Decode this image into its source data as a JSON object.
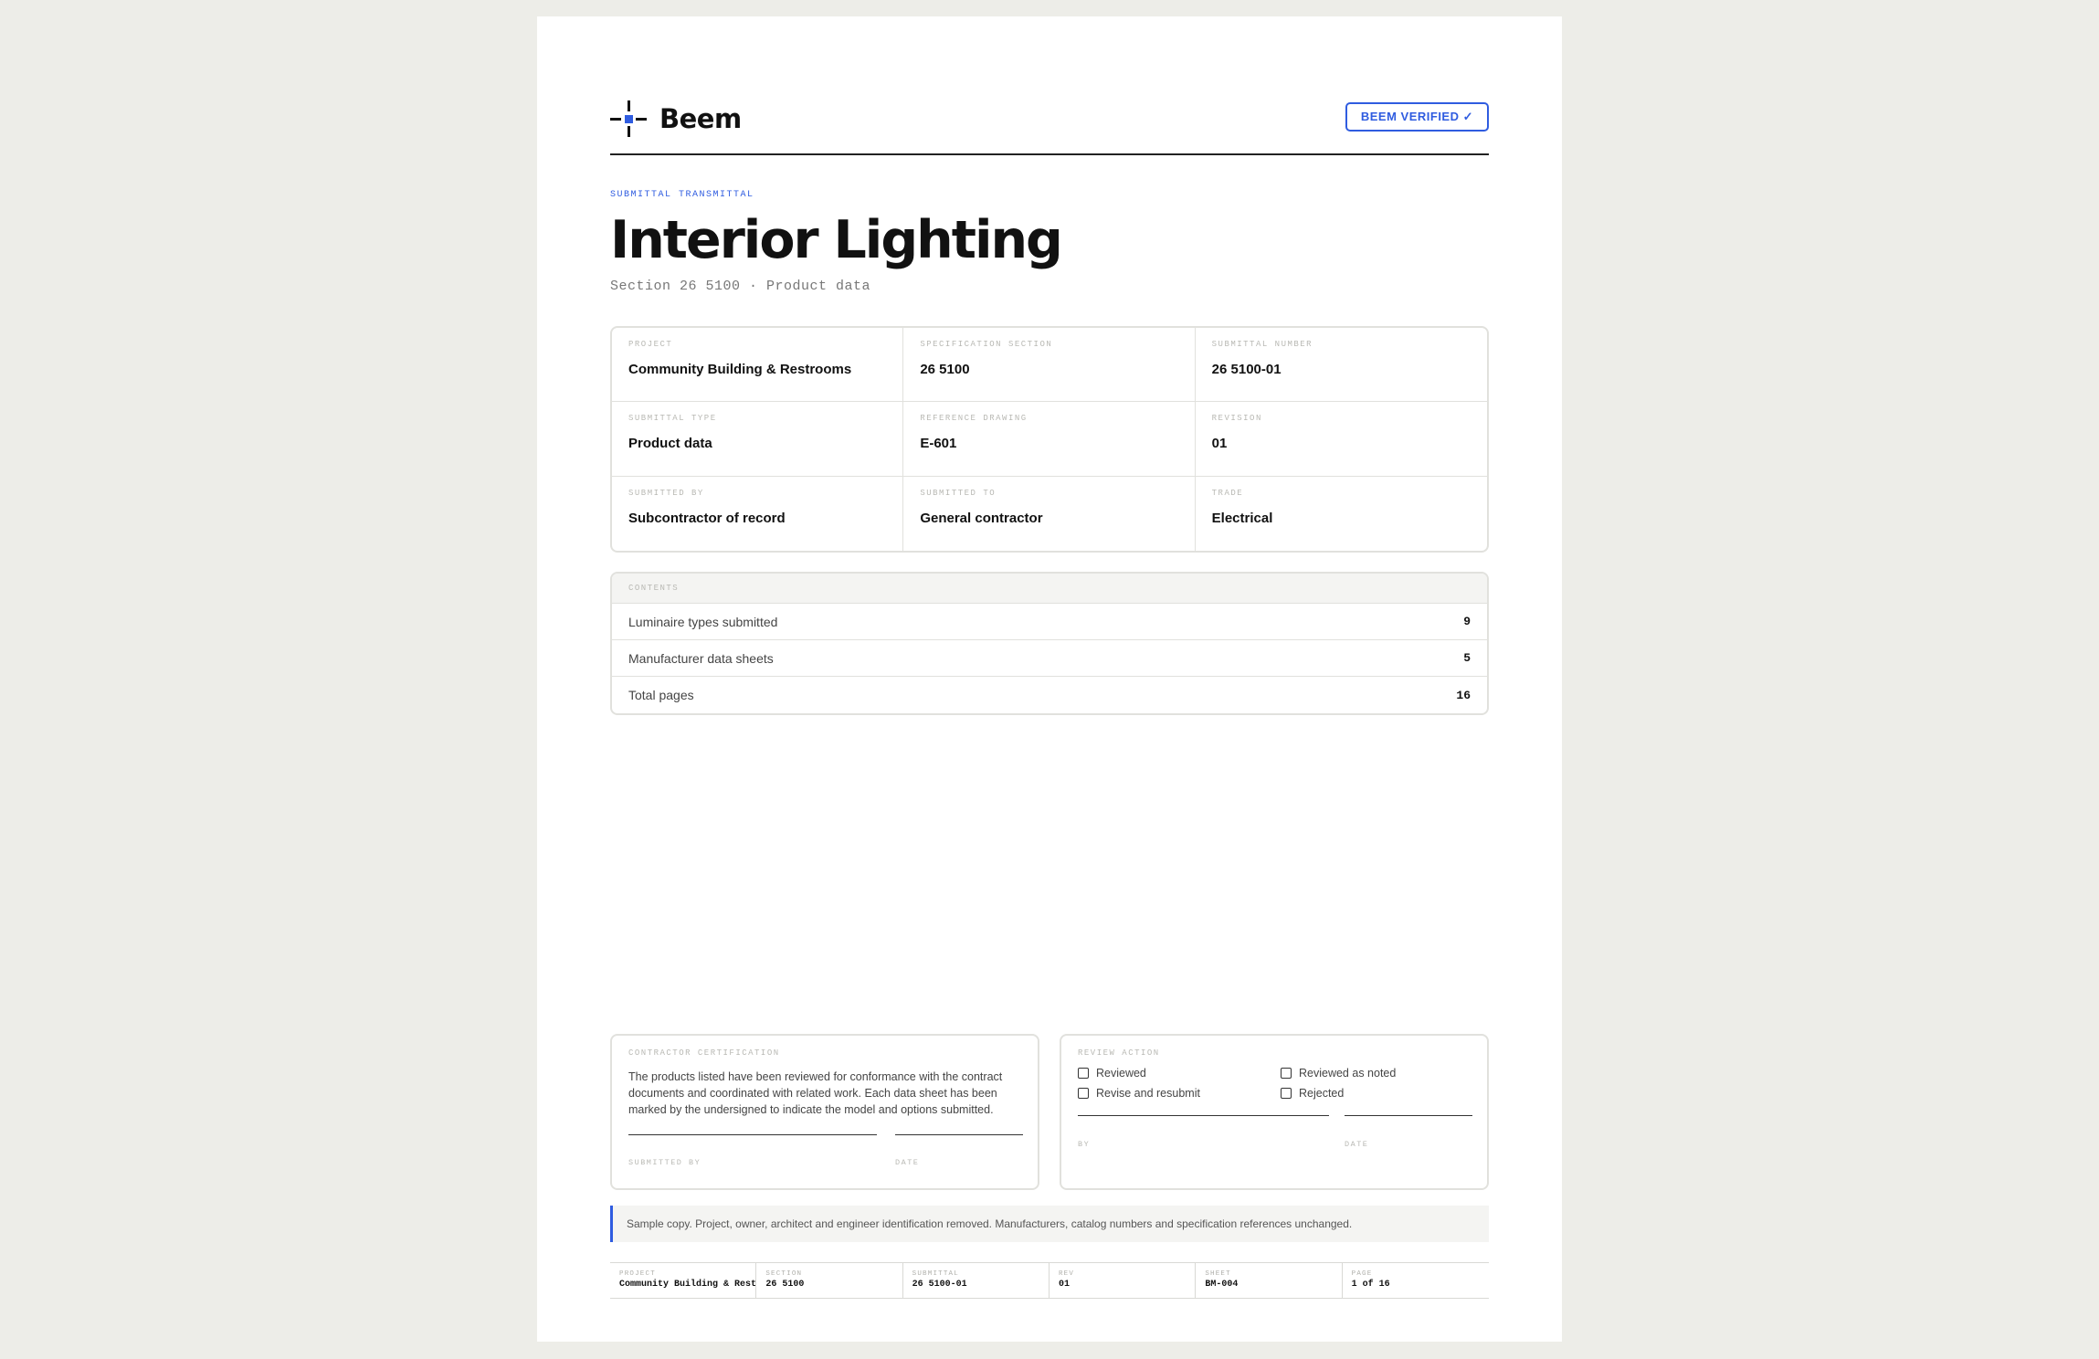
{
  "header": {
    "brand": "Beem",
    "badge": "BEEM VERIFIED ✓"
  },
  "doc": {
    "eyebrow": "SUBMITTAL TRANSMITTAL",
    "title": "Interior Lighting",
    "subtitle": "Section 26 5100 · Product data"
  },
  "info": [
    {
      "label": "PROJECT",
      "value": "Community Building & Restrooms"
    },
    {
      "label": "SPECIFICATION SECTION",
      "value": "26 5100"
    },
    {
      "label": "SUBMITTAL NUMBER",
      "value": "26 5100-01"
    },
    {
      "label": "SUBMITTAL TYPE",
      "value": "Product data"
    },
    {
      "label": "REFERENCE DRAWING",
      "value": "E-601"
    },
    {
      "label": "REVISION",
      "value": "01"
    },
    {
      "label": "SUBMITTED BY",
      "value": "Subcontractor of record"
    },
    {
      "label": "SUBMITTED TO",
      "value": "General contractor"
    },
    {
      "label": "TRADE",
      "value": "Electrical"
    }
  ],
  "contents": {
    "heading": "CONTENTS",
    "rows": [
      {
        "label": "Luminaire types submitted",
        "value": "9"
      },
      {
        "label": "Manufacturer data sheets",
        "value": "5"
      },
      {
        "label": "Total pages",
        "value": "16"
      }
    ]
  },
  "certification": {
    "heading": "CONTRACTOR CERTIFICATION",
    "text": "The products listed have been reviewed for conformance with the contract documents and coordinated with related work. Each data sheet has been marked by the undersigned to indicate the model and options submitted.",
    "sig_label": "SUBMITTED BY",
    "date_label": "DATE"
  },
  "review": {
    "heading": "REVIEW ACTION",
    "options": [
      "Reviewed",
      "Reviewed as noted",
      "Revise and resubmit",
      "Rejected"
    ],
    "by_label": "BY",
    "date_label": "DATE"
  },
  "note": "Sample copy. Project, owner, architect and engineer identification removed. Manufacturers, catalog numbers and specification references unchanged.",
  "footer": [
    {
      "label": "PROJECT",
      "value": "Community Building & Rest"
    },
    {
      "label": "SECTION",
      "value": "26 5100"
    },
    {
      "label": "SUBMITTAL",
      "value": "26 5100-01"
    },
    {
      "label": "REV",
      "value": "01"
    },
    {
      "label": "SHEET",
      "value": "BM-004"
    },
    {
      "label": "PAGE",
      "value": "1 of 16"
    }
  ]
}
